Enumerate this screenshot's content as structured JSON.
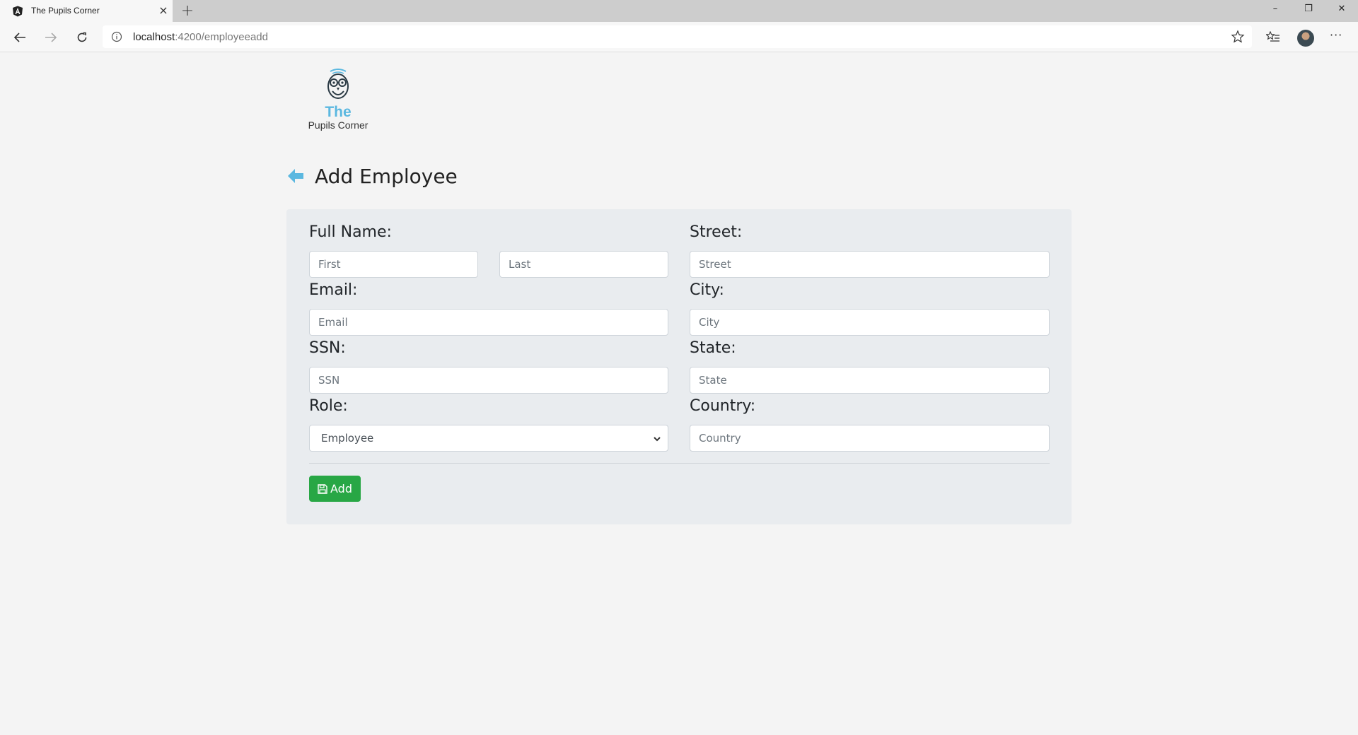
{
  "browser": {
    "tab_title": "The Pupils Corner",
    "tab_close": "×",
    "new_tab": "+",
    "url_host": "localhost",
    "url_path": ":4200/employeeadd",
    "window_controls": {
      "minimize": "–",
      "restore": "❐",
      "close": "✕"
    },
    "more": "···"
  },
  "logo": {
    "line1": "The",
    "line2": "Pupils Corner"
  },
  "page": {
    "title": "Add Employee"
  },
  "form": {
    "full_name_label": "Full Name:",
    "first_placeholder": "First",
    "last_placeholder": "Last",
    "email_label": "Email:",
    "email_placeholder": "Email",
    "ssn_label": "SSN:",
    "ssn_placeholder": "SSN",
    "role_label": "Role:",
    "role_value": "Employee",
    "street_label": "Street:",
    "street_placeholder": "Street",
    "city_label": "City:",
    "city_placeholder": "City",
    "state_label": "State:",
    "state_placeholder": "State",
    "country_label": "Country:",
    "country_placeholder": "Country",
    "add_label": "Add"
  },
  "colors": {
    "accent": "#5bb8e0",
    "button": "#28a745",
    "card": "#e9ecef",
    "background": "#f4f4f4"
  }
}
